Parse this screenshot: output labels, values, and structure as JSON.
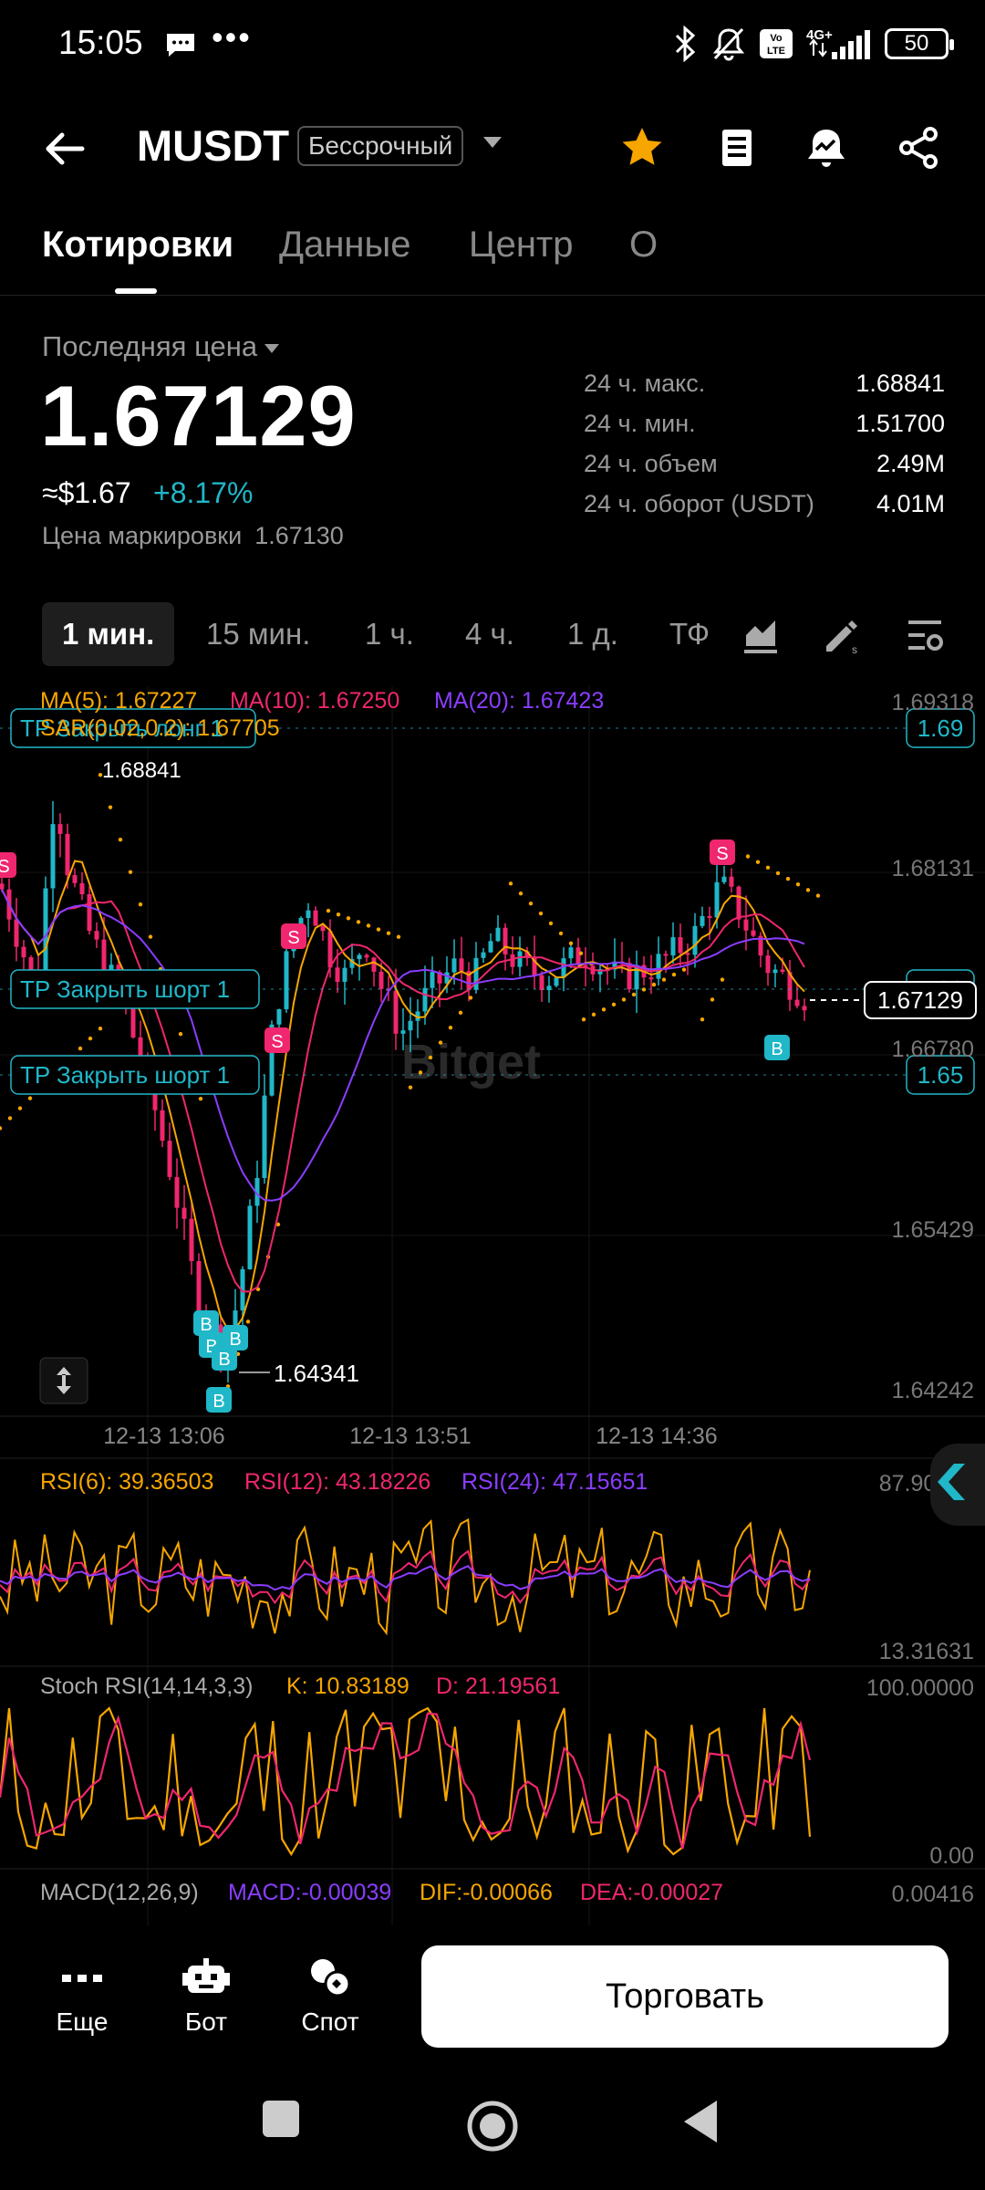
{
  "status_bar": {
    "time": "15:05",
    "dots": "•••",
    "network": "4G+",
    "volte": "Vo LTE",
    "battery": "50"
  },
  "header": {
    "symbol": "MUSDT",
    "contract_type": "Бессрочный",
    "icons": [
      "back-arrow-icon",
      "star-icon",
      "document-icon",
      "alert-icon",
      "share-icon"
    ],
    "accent_color": "#f7a600"
  },
  "tabs": [
    {
      "label": "Котировки",
      "active": true
    },
    {
      "label": "Данные",
      "active": false
    },
    {
      "label": "Центр",
      "active": false
    },
    {
      "label": "О",
      "active": false
    }
  ],
  "price": {
    "last_label": "Последняя цена",
    "last_price": "1.67129",
    "usd_approx": "≈$1.67",
    "change": "+8.17%",
    "mark_label": "Цена маркировки",
    "mark_value": "1.67130",
    "up_color": "#20b7c8"
  },
  "stats": [
    {
      "label": "24 ч. макс.",
      "value": "1.68841"
    },
    {
      "label": "24 ч. мин.",
      "value": "1.51700"
    },
    {
      "label": "24 ч. объем",
      "value": "2.49M"
    },
    {
      "label": "24 ч. оборот (USDT)",
      "value": "4.01M"
    }
  ],
  "intervals": {
    "items": [
      "1 мин.",
      "15 мин.",
      "1 ч.",
      "4 ч.",
      "1 д.",
      "ТФ"
    ],
    "active": "1 мин.",
    "icons": [
      "indicator-icon",
      "draw-icon",
      "settings-icon"
    ]
  },
  "chart": {
    "ma_labels": {
      "ma5": "MA(5): 1.67227",
      "ma10": "MA(10): 1.67250",
      "ma20": "MA(20): 1.67423"
    },
    "sar_label": "SAR(0.02,0.2): 1.67705",
    "price_axis": [
      "1.69318",
      "1.68131",
      "1.67129",
      "1.66780",
      "1.65429",
      "1.64242"
    ],
    "current_price_tag": "1.67129",
    "tp_lines": [
      {
        "label": "TP Закрыть лонг 1",
        "price": "1.69"
      },
      {
        "label": "TP Закрыть шорт 1",
        "price": "1.66"
      },
      {
        "label": "TP Закрыть шорт 1",
        "price": "1.65"
      }
    ],
    "high_label": "1.68841",
    "low_label": "1.64341",
    "time_axis": [
      "12-13 13:06",
      "12-13 13:51",
      "12-13 14:36"
    ],
    "watermark": "Bitget",
    "buy_marker": "B",
    "sell_marker": "S",
    "colors": {
      "ma5": "#f7a600",
      "ma10": "#f0266e",
      "ma20": "#8b3dff",
      "up": "#20b7c8",
      "down": "#f0266e",
      "sar": "#f7a600"
    }
  },
  "rsi": {
    "labels": {
      "rsi6": "RSI(6): 39.36503",
      "rsi12": "RSI(12): 43.18226",
      "rsi24": "RSI(24): 47.15651"
    },
    "axis_top": "87.90973",
    "axis_bottom": "13.31631"
  },
  "stoch": {
    "title": "Stoch RSI(14,14,3,3)",
    "k": "K: 10.83189",
    "d": "D: 21.19561",
    "axis_top": "100.00000",
    "axis_bottom": "0.00"
  },
  "macd": {
    "title": "MACD(12,26,9)",
    "macd": "MACD:-0.00039",
    "dif": "DIF:-0.00066",
    "dea": "DEA:-0.00027",
    "axis_top": "0.00416"
  },
  "bottom": {
    "more": "Еще",
    "bot": "Бот",
    "spot": "Спот",
    "trade": "Торговать"
  }
}
